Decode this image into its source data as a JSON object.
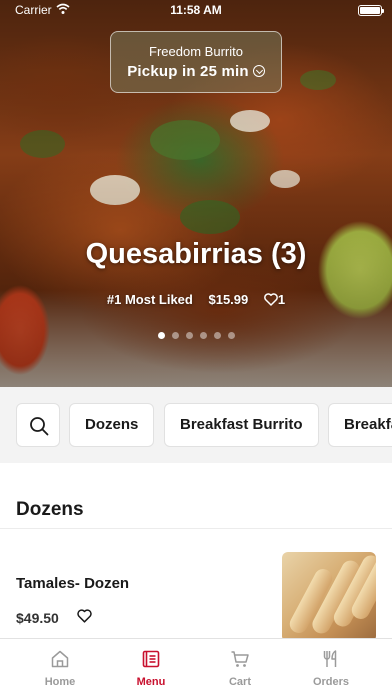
{
  "status_bar": {
    "carrier": "Carrier",
    "time": "11:58 AM"
  },
  "store": {
    "name": "Freedom Burrito",
    "pickup": "Pickup in 25 min",
    "chevron_icon": "chevron-down-circle-icon"
  },
  "featured": {
    "title": "Quesabirrias (3)",
    "badge": "#1 Most Liked",
    "price": "$15.99",
    "likes": "1",
    "slides_total": 6,
    "slide_active": 1
  },
  "categories": {
    "search_icon": "search-icon",
    "items": [
      "Dozens",
      "Breakfast Burrito",
      "Breakfa"
    ]
  },
  "section": {
    "title": "Dozens"
  },
  "menu_items": [
    {
      "name": "Tamales- Dozen",
      "price": "$49.50"
    }
  ],
  "tab_bar": {
    "tabs": [
      {
        "label": "Home",
        "icon": "home-icon",
        "active": false
      },
      {
        "label": "Menu",
        "icon": "menu-icon",
        "active": true
      },
      {
        "label": "Cart",
        "icon": "cart-icon",
        "active": false
      },
      {
        "label": "Orders",
        "icon": "utensils-icon",
        "active": false
      }
    ]
  },
  "colors": {
    "accent": "#c8102e",
    "inactive": "#9a9a9a"
  }
}
